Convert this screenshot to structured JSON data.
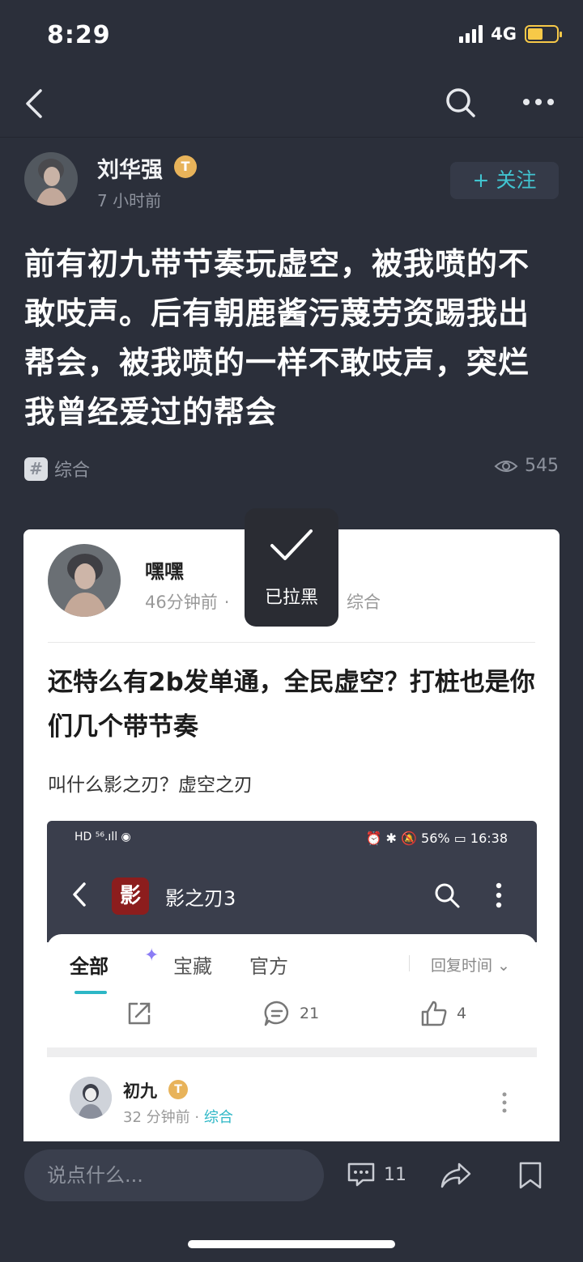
{
  "status_bar": {
    "time": "8:29",
    "network": "4G"
  },
  "post": {
    "author": "刘华强",
    "badge": "T",
    "time_ago": "7 小时前",
    "follow_label": "+ 关注",
    "title": "前有初九带节奏玩虚空，被我喷的不敢吱声。后有朝鹿酱污蔑劳资踢我出帮会，被我喷的一样不敢吱声，突烂我曾经爱过的帮会",
    "tag_symbol": "#",
    "tag": "综合",
    "views": "545"
  },
  "embedded": {
    "author": "嘿嘿",
    "time_ago": "46分钟前",
    "dot": "·",
    "topic": "综合",
    "title": "还特么有2b发单通，全民虚空？打桩也是你们几个带节奏",
    "body": "叫什么影之刃？虚空之刃",
    "screenshot": {
      "status_left": "HD ⁵⁶.ıll ◉",
      "status_right": "⏰ ✱ 🔕 56% ▭ 16:38",
      "logo_text": "影",
      "app_title": "影之刃3",
      "tabs": [
        "全部",
        "宝藏",
        "官方"
      ],
      "sort_label": "回复时间 ⌄",
      "comment_count": "21",
      "like_count": "4",
      "item": {
        "author": "初九",
        "badge": "T",
        "time_ago": "32 分钟前",
        "dot": "·",
        "topic": "综合"
      }
    }
  },
  "toast": {
    "text": "已拉黑"
  },
  "bottom_bar": {
    "input_placeholder": "说点什么...",
    "comment_count": "11"
  },
  "icons": [
    "back-icon",
    "search-icon",
    "more-icon",
    "eye-icon",
    "check-icon",
    "share-icon",
    "comment-icon",
    "like-icon",
    "bookmark-icon"
  ]
}
